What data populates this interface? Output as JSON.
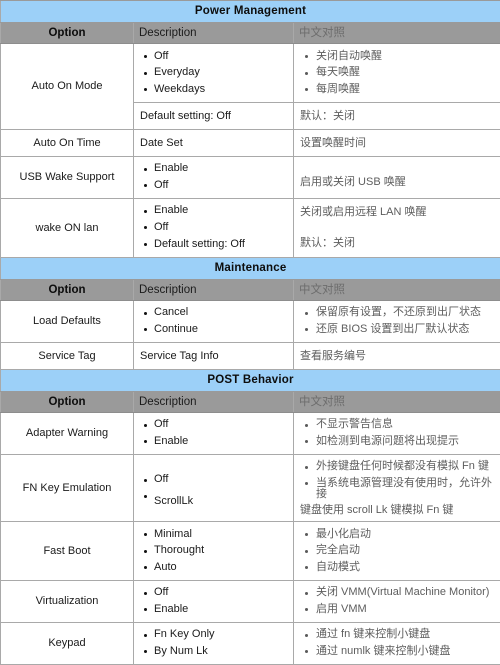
{
  "document": {
    "title": "Power Management / Maintenance / POST Behavior BIOS options",
    "column_headers": {
      "option": "Option",
      "description": "Description",
      "chinese": "中文对照"
    },
    "colors": {
      "section_banner": "#9cd0f8",
      "column_header": "#9a9a9a",
      "border": "#a9a9a9",
      "page_background": "#ffffff"
    }
  },
  "sections": [
    {
      "name": "Power Management",
      "rows": [
        {
          "option": "Auto On Mode",
          "desc_bullets": [
            "Off",
            "Everyday",
            "Weekdays"
          ],
          "desc_footer": "Default setting: Off",
          "cn_bullets": [
            "关闭自动唤醒",
            "每天唤醒",
            "每周唤醒"
          ],
          "cn_footer": "默认：关闭"
        },
        {
          "option": "Auto On Time",
          "desc_plain": "Date Set",
          "cn_plain": "设置唤醒时间"
        },
        {
          "option": "USB Wake Support",
          "desc_bullets": [
            "Enable",
            "Off"
          ],
          "cn_plain": "启用或关闭 USB 唤醒"
        },
        {
          "option": "wake ON lan",
          "desc_bullets": [
            "Enable",
            "Off",
            "Default setting: Off"
          ],
          "cn_plain": "关闭或启用远程 LAN 唤醒",
          "cn_plain2": "默认：关闭"
        }
      ]
    },
    {
      "name": "Maintenance",
      "rows": [
        {
          "option": "Load Defaults",
          "desc_bullets": [
            "Cancel",
            "Continue"
          ],
          "cn_bullets": [
            "保留原有设置，不还原到出厂状态",
            "还原 BIOS 设置到出厂默认状态"
          ]
        },
        {
          "option": "Service Tag",
          "desc_plain": "Service Tag Info",
          "cn_plain": "查看服务编号"
        }
      ]
    },
    {
      "name": "POST Behavior",
      "rows": [
        {
          "option": "Adapter Warning",
          "desc_bullets": [
            "Off",
            "Enable"
          ],
          "cn_bullets": [
            "不显示警告信息",
            "如检测到电源问题将出现提示"
          ]
        },
        {
          "option": "FN Key Emulation",
          "desc_bullets": [
            "Off",
            "ScrollLk"
          ],
          "cn_bullets": [
            "外接键盘任何时候都没有模拟 Fn 键",
            "当系统电源管理没有使用时，允许外接"
          ],
          "cn_wrap": "键盘使用 scroll Lk 键模拟 Fn 键"
        },
        {
          "option": "Fast Boot",
          "desc_bullets": [
            "Minimal",
            "Thorought",
            "Auto"
          ],
          "cn_bullets": [
            "最小化启动",
            "完全启动",
            "自动模式"
          ]
        },
        {
          "option": "Virtualization",
          "desc_bullets": [
            "Off",
            "Enable"
          ],
          "cn_bullets": [
            "关闭 VMM(Virtual Machine Monitor)",
            "启用 VMM"
          ]
        },
        {
          "option": "Keypad",
          "desc_bullets": [
            "Fn Key Only",
            "By Num Lk"
          ],
          "cn_bullets": [
            "通过 fn 键来控制小键盘",
            "通过 numlk 键来控制小键盘"
          ]
        }
      ]
    }
  ]
}
